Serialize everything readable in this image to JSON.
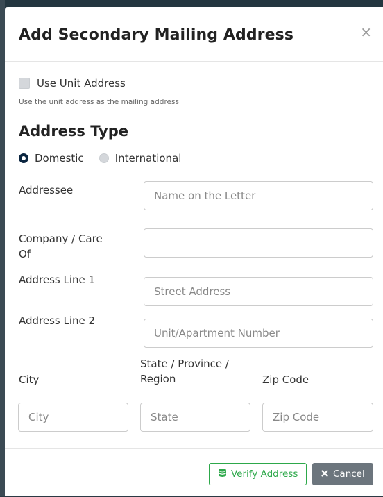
{
  "modal": {
    "title": "Add Secondary Mailing Address",
    "close_glyph": "×"
  },
  "use_unit": {
    "label": "Use Unit Address",
    "help": "Use the unit address as the mailing address",
    "checked": false
  },
  "address_type": {
    "title": "Address Type",
    "options": [
      {
        "label": "Domestic",
        "selected": true
      },
      {
        "label": "International",
        "selected": false
      }
    ]
  },
  "fields": {
    "addressee": {
      "label": "Addressee",
      "placeholder": "Name on the Letter"
    },
    "company": {
      "label_line1": "Company / Care",
      "label_line2": "Of",
      "placeholder": ""
    },
    "address1": {
      "label": "Address Line 1",
      "placeholder": "Street Address"
    },
    "address2": {
      "label": "Address Line 2",
      "placeholder": "Unit/Apartment Number"
    },
    "city": {
      "label": "City",
      "placeholder": "City"
    },
    "state": {
      "label_line1": "State / Province /",
      "label_line2": "Region",
      "placeholder": "State"
    },
    "zip": {
      "label": "Zip Code",
      "placeholder": "Zip Code"
    }
  },
  "footer": {
    "verify_label": "Verify Address",
    "cancel_label": "Cancel",
    "verify_icon": "database-icon",
    "cancel_icon": "times-icon"
  },
  "colors": {
    "verify_green": "#2da84a",
    "cancel_gray": "#6c757d",
    "radio_selected": "#0a2540"
  }
}
